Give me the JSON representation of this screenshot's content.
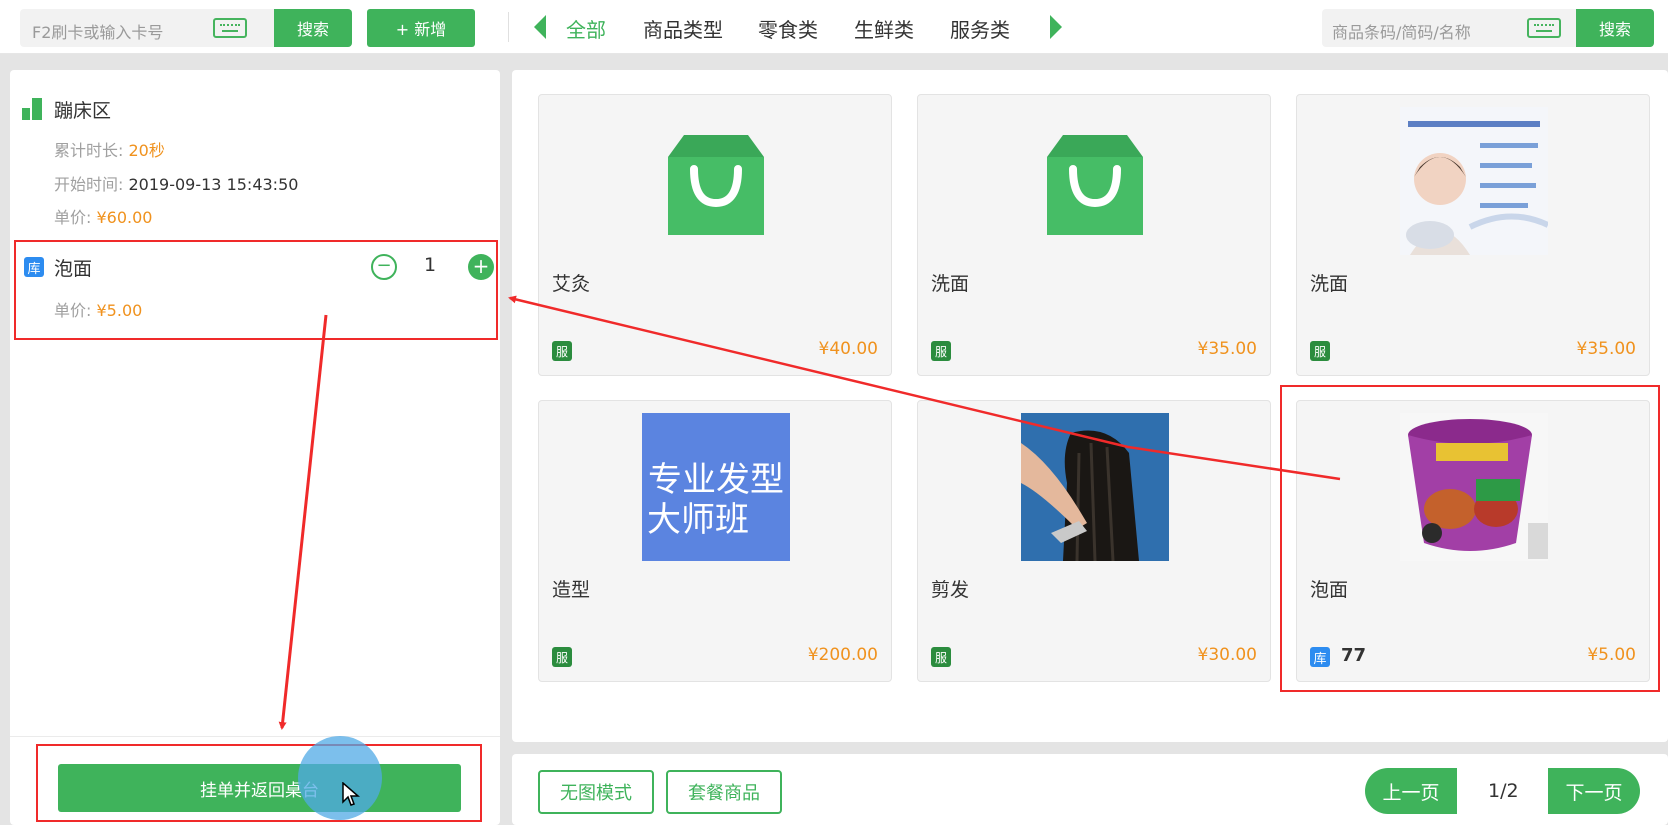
{
  "topbar": {
    "card_placeholder": "F2刷卡或输入卡号",
    "search_label": "搜索",
    "add_label": "+ 新增",
    "categories": [
      "全部",
      "商品类型",
      "零食类",
      "生鲜类",
      "服务类"
    ],
    "product_placeholder": "商品条码/简码/名称",
    "product_search_label": "搜索"
  },
  "room": {
    "name": "蹦床区",
    "duration_label": "累计时长:",
    "duration_value": "20秒",
    "start_label": "开始时间:",
    "start_value": "2019-09-13 15:43:50",
    "price_label": "单价:",
    "price_value": "¥60.00"
  },
  "order_item": {
    "tag": "库",
    "name": "泡面",
    "qty": "1",
    "price_label": "单价:",
    "price_value": "¥5.00",
    "minus": "−",
    "plus": "+"
  },
  "hang_button_label": "挂单并返回桌台",
  "products": [
    {
      "name": "艾灸",
      "tag": "服",
      "price": "¥40.00"
    },
    {
      "name": "洗面",
      "tag": "服",
      "price": "¥35.00"
    },
    {
      "name": "洗面",
      "tag": "服",
      "price": "¥35.00"
    },
    {
      "name": "造型",
      "tag": "服",
      "price": "¥200.00",
      "image_text": [
        "专业发型",
        "大师班"
      ]
    },
    {
      "name": "剪发",
      "tag": "服",
      "price": "¥30.00"
    },
    {
      "name": "泡面",
      "tag": "库",
      "stock": "77",
      "price": "¥5.00"
    }
  ],
  "bottom": {
    "no_image_mode": "无图模式",
    "combo_products": "套餐商品",
    "prev_page": "上一页",
    "page_indicator": "1/2",
    "next_page": "下一页"
  },
  "colors": {
    "accent": "#3fb35b",
    "price": "#f0921e",
    "annotation": "#f02a2a",
    "stock_tag": "#2d8cf0"
  }
}
